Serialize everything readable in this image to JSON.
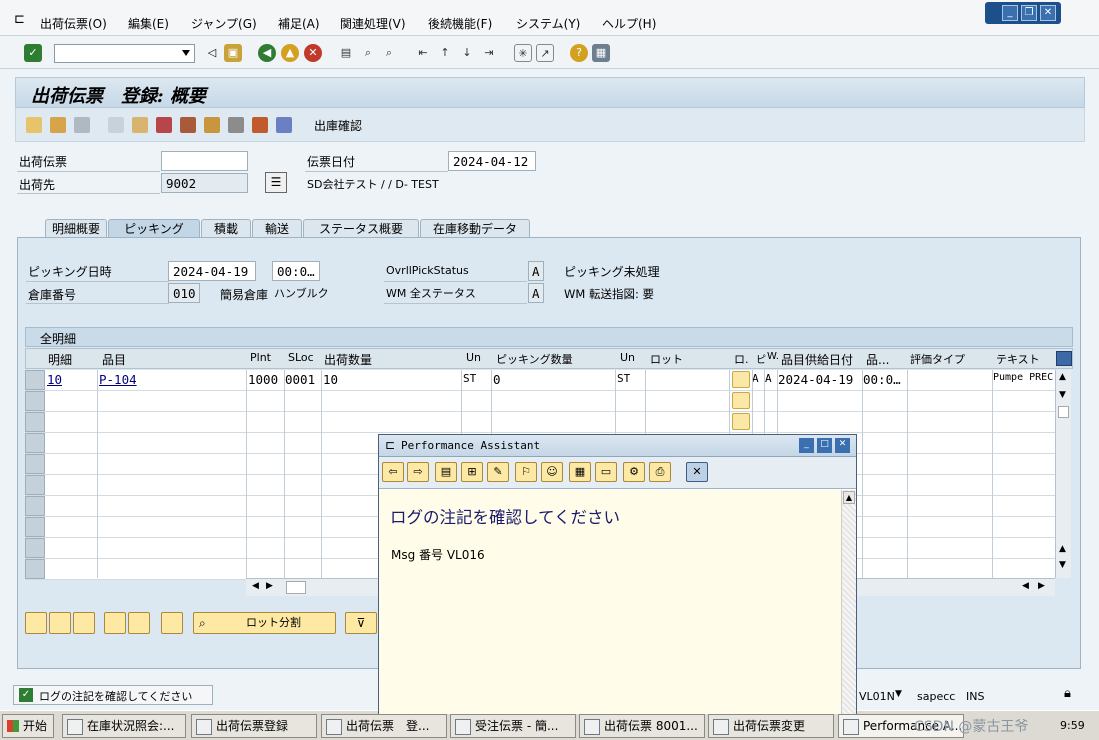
{
  "menu": {
    "items": [
      "出荷伝票(O)",
      "編集(E)",
      "ジャンプ(G)",
      "補足(A)",
      "関連処理(V)",
      "後続機能(F)",
      "システム(Y)",
      "ヘルプ(H)"
    ]
  },
  "window": {
    "title": "出荷伝票　登録: 概要"
  },
  "app_toolbar": {
    "goods_issue_label": "出庫確認"
  },
  "header": {
    "delivery_label": "出荷伝票",
    "delivery_value": "",
    "date_label": "伝票日付",
    "date_value": "2024-04-12",
    "shipto_label": "出荷先",
    "shipto_value": "9002",
    "shipto_name": "SD会社テスト / / D- TEST"
  },
  "tabs": [
    "明細概要",
    "ピッキング",
    "積載",
    "輸送",
    "ステータス概要",
    "在庫移動データ"
  ],
  "active_tab": "ピッキング",
  "picking": {
    "pick_date_label": "ピッキング日時",
    "pick_date": "2024-04-19",
    "pick_time": "00:0…",
    "overall_label": "OvrllPickStatus",
    "overall_value": "A",
    "overall_text": "ピッキング未処理",
    "wh_label": "倉庫番号",
    "wh_value": "010",
    "wh_desc": "簡易倉庫",
    "wh_name": "ハンブルク",
    "wm_label": "WM 全ステータス",
    "wm_value": "A",
    "wm_text": "WM 転送指図: 要"
  },
  "table": {
    "title": "全明細",
    "columns": [
      "明細",
      "品目",
      "Plnt",
      "SLoc",
      "出荷数量",
      "Un",
      "ピッキング数量",
      "Un",
      "ロット",
      "ロ.",
      "ピ",
      "W.",
      "品目供給日付",
      "品...",
      "評価タイプ",
      "テキスト"
    ],
    "rows": [
      {
        "item": "10",
        "material": "P-104",
        "plant": "1000",
        "sloc": "0001",
        "qty": "10",
        "un": "ST",
        "pickqty": "0",
        "un2": "ST",
        "batch": "",
        "p": "A",
        "w": "A",
        "avail_date": "2024-04-19",
        "time": "00:0…",
        "text": "Pumpe PREC"
      }
    ]
  },
  "buttons": {
    "batch_split": "ロット分割"
  },
  "status": {
    "message": "ログの注記を確認してください",
    "tcode": "VL01N",
    "server": "sapecc",
    "mode": "INS"
  },
  "popup": {
    "title": "Performance Assistant",
    "heading": "ログの注記を確認してください",
    "msg": "Msg 番号  VL016"
  },
  "taskbar": {
    "start": "开始",
    "tasks": [
      "在庫状況照会:...",
      "出荷伝票登録",
      "出荷伝票　登...",
      "受注伝票 - 簡...",
      "出荷伝票 8001...",
      "出荷伝票変更",
      "Performance A..."
    ],
    "clock": "9:59",
    "watermark": "CSDN @蒙古王爷"
  },
  "colors": {
    "accent": "#1d4f8a",
    "link": "#00007f",
    "button": "#fde9a3"
  }
}
